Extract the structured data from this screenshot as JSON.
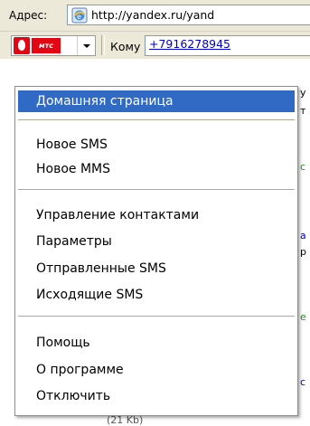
{
  "address_bar": {
    "label": "Адрес:",
    "url": "http://yandex.ru/yand",
    "icon": "ie-page-icon"
  },
  "toolbar": {
    "mts_badge": "мтс",
    "komu_label": "Кому",
    "komu_value": "+7916278945",
    "brand_color": "#e30613"
  },
  "menu": {
    "accent": "#316ac5",
    "items": [
      {
        "label": "Домашняя страница",
        "active": true
      },
      {
        "label": "Новое SMS"
      },
      {
        "label": "Новое MMS"
      },
      {
        "label": "Управление контактами"
      },
      {
        "label": "Параметры"
      },
      {
        "label": "Отправленные SMS"
      },
      {
        "label": "Исходящие SMS"
      },
      {
        "label": "Помощь"
      },
      {
        "label": "О программе"
      },
      {
        "label": "Отключить"
      }
    ]
  },
  "background": {
    "bottom_text": "(21 Kb)"
  }
}
